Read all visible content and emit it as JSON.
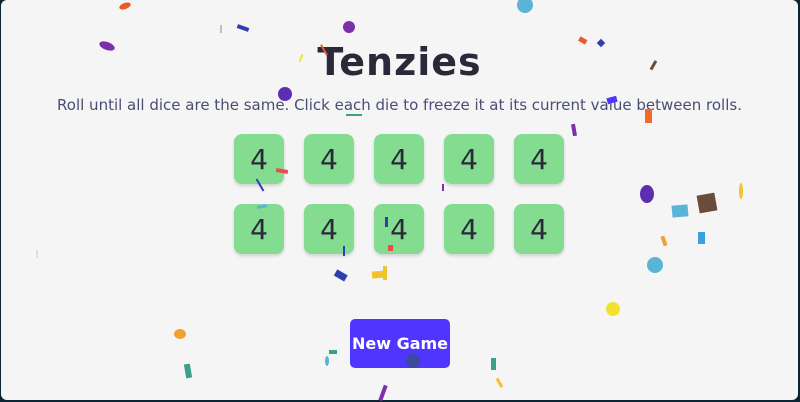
{
  "game": {
    "title": "Tenzies",
    "instructions": "Roll until all dice are the same. Click each die to freeze it at its current value between rolls.",
    "dice": [
      4,
      4,
      4,
      4,
      4,
      4,
      4,
      4,
      4,
      4
    ],
    "new_game_label": "New Game"
  },
  "colors": {
    "background": "#f5f5f6",
    "die_held": "#84dc90",
    "button": "#5035ff",
    "frame": "#0b2434"
  }
}
